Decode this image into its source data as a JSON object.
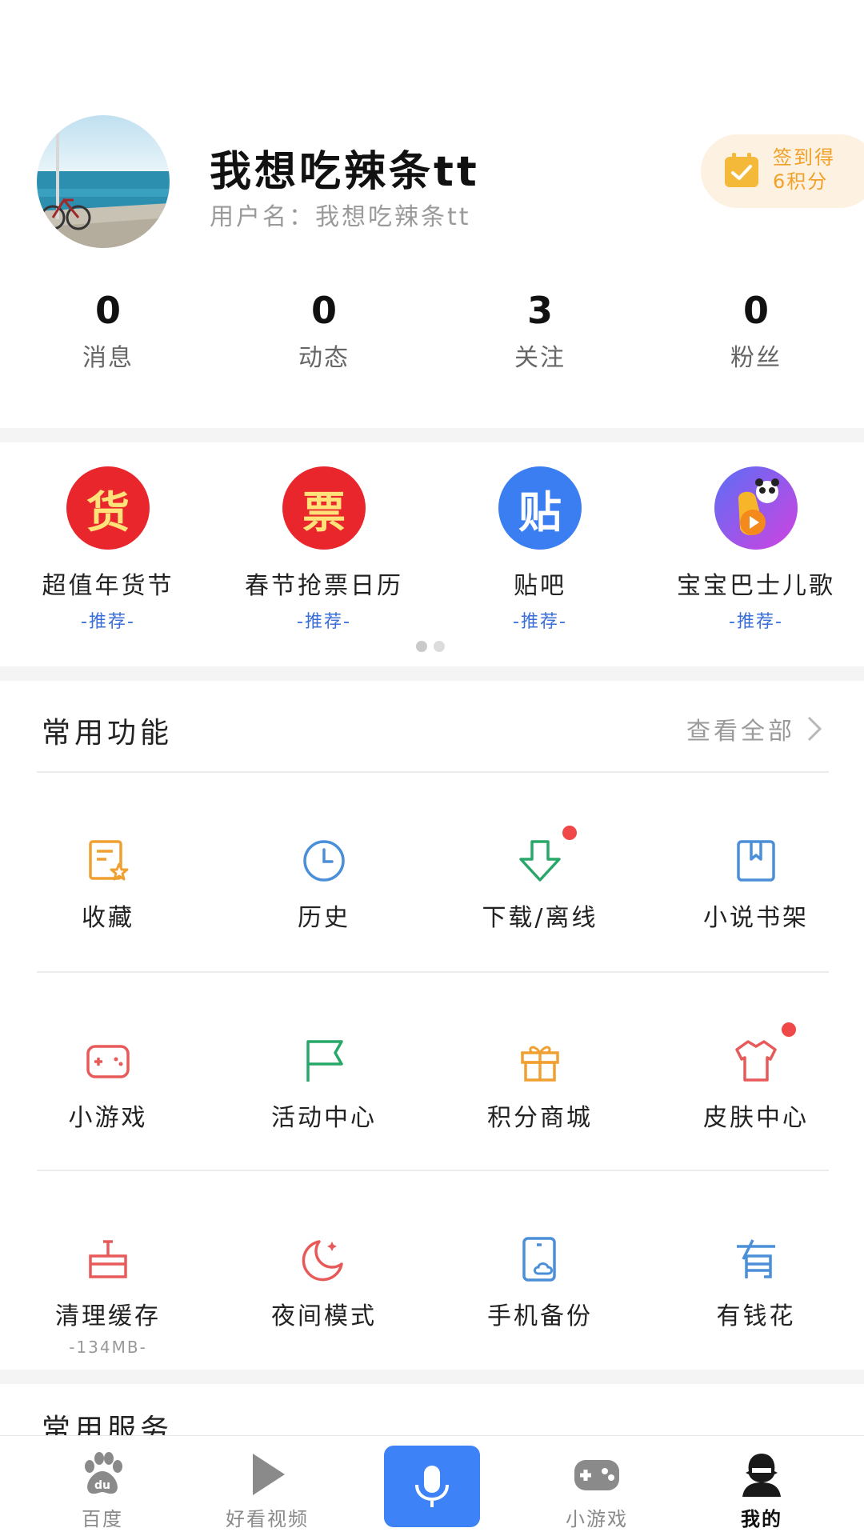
{
  "profile": {
    "nickname": "我想吃辣条tt",
    "username": "用户名：我想吃辣条tt",
    "signin_line1": "签到得",
    "signin_line2": "6积分",
    "stats": [
      {
        "value": "0",
        "label": "消息"
      },
      {
        "value": "0",
        "label": "动态"
      },
      {
        "value": "3",
        "label": "关注"
      },
      {
        "value": "0",
        "label": "粉丝"
      }
    ]
  },
  "recommend": {
    "items": [
      {
        "glyph": "货",
        "title": "超值年货节",
        "tag": "-推荐-",
        "color": "#e8262c"
      },
      {
        "glyph": "票",
        "title": "春节抢票日历",
        "tag": "-推荐-",
        "color": "#e8262c"
      },
      {
        "glyph": "贴",
        "title": "贴吧",
        "tag": "-推荐-",
        "color": "#3a7ef2"
      },
      {
        "glyph": "",
        "title": "宝宝巴士儿歌",
        "tag": "-推荐-",
        "color": "#a04ee8"
      }
    ],
    "page_count": 2,
    "active_page": 1
  },
  "functions": {
    "title": "常用功能",
    "view_all": "查看全部",
    "rows": [
      [
        {
          "label": "收藏",
          "icon": "favorite-icon",
          "color": "#f0a030"
        },
        {
          "label": "历史",
          "icon": "clock-icon",
          "color": "#4a8fd8"
        },
        {
          "label": "下载/离线",
          "icon": "download-icon",
          "color": "#28a868",
          "badge": true
        },
        {
          "label": "小说书架",
          "icon": "book-icon",
          "color": "#4a8fd8"
        }
      ],
      [
        {
          "label": "小游戏",
          "icon": "gamepad-icon",
          "color": "#e85a5a"
        },
        {
          "label": "活动中心",
          "icon": "flag-icon",
          "color": "#28a868"
        },
        {
          "label": "积分商城",
          "icon": "gift-icon",
          "color": "#f0a030"
        },
        {
          "label": "皮肤中心",
          "icon": "shirt-icon",
          "color": "#e85a5a",
          "badge": true
        }
      ],
      [
        {
          "label": "清理缓存",
          "icon": "clean-icon",
          "color": "#e85a5a",
          "sub": "-134MB-"
        },
        {
          "label": "夜间模式",
          "icon": "moon-icon",
          "color": "#e85a5a"
        },
        {
          "label": "手机备份",
          "icon": "phone-backup-icon",
          "color": "#4a8fd8"
        },
        {
          "label": "有钱花",
          "icon": "money-icon",
          "color": "#4a8fd8"
        }
      ]
    ]
  },
  "services": {
    "title": "常用服务"
  },
  "bottom_nav": {
    "items": [
      {
        "label": "百度",
        "icon": "baidu-paw-icon"
      },
      {
        "label": "好看视频",
        "icon": "play-icon"
      },
      {
        "label": "",
        "icon": "microphone-icon"
      },
      {
        "label": "小游戏",
        "icon": "gamepad-icon"
      },
      {
        "label": "我的",
        "icon": "profile-icon"
      }
    ],
    "active": "我的",
    "accent": "#3e82f7"
  }
}
